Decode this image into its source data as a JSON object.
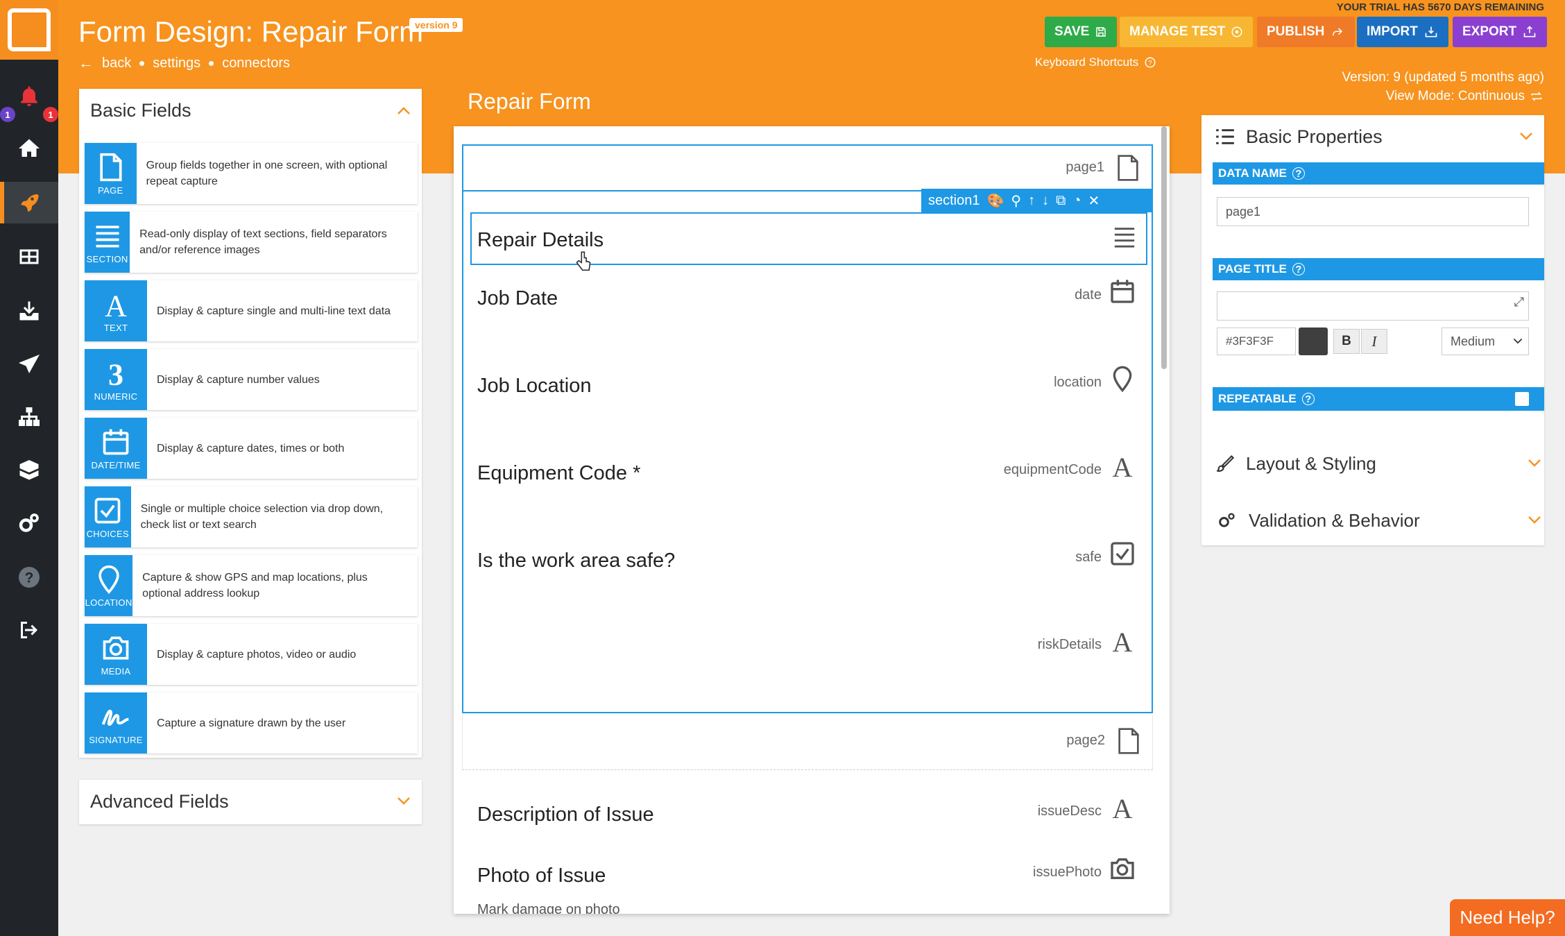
{
  "app": {
    "title": "Form Design: Repair Form",
    "version_tag": "version 9",
    "trial": "YOUR TRIAL HAS 5670 DAYS REMAINING"
  },
  "nav": {
    "back": "back",
    "settings": "settings",
    "connectors": "connectors"
  },
  "rail": {
    "notif_badge_left": "1",
    "notif_badge_right": "1",
    "icons": [
      "bell-icon",
      "home-icon",
      "rocket-icon",
      "table-icon",
      "download-icon",
      "send-icon",
      "sitemap-icon",
      "boxes-icon",
      "gears-icon",
      "help-icon",
      "logout-icon"
    ]
  },
  "toolbar": {
    "save": "SAVE",
    "manage_test": "MANAGE TEST",
    "publish": "PUBLISH",
    "import": "IMPORT",
    "export": "EXPORT",
    "keyboard_shortcuts": "Keyboard Shortcuts",
    "colors": {
      "save": "#2eab48",
      "manage": "#f7b733",
      "publish": "#ef7a27",
      "import": "#1a6fc2",
      "export": "#8a3fd1"
    }
  },
  "version_info": {
    "line1": "Version: 9 (updated 5 months ago)",
    "line2": "View Mode: Continuous"
  },
  "basic_fields": {
    "title": "Basic Fields",
    "items": [
      {
        "tile": "PAGE",
        "desc": "Group fields together in one screen, with optional repeat capture",
        "icon": "page-icon"
      },
      {
        "tile": "SECTION",
        "desc": "Read-only display of text sections, field separators and/or reference images",
        "icon": "section-icon"
      },
      {
        "tile": "TEXT",
        "desc": "Display & capture single and multi-line text data",
        "icon": "text-icon"
      },
      {
        "tile": "NUMERIC",
        "desc": "Display & capture number values",
        "icon": "numeric-icon"
      },
      {
        "tile": "DATE/TIME",
        "desc": "Display & capture dates, times or both",
        "icon": "calendar-icon"
      },
      {
        "tile": "CHOICES",
        "desc": "Single or multiple choice selection via drop down, check list or text search",
        "icon": "checkbox-icon"
      },
      {
        "tile": "LOCATION",
        "desc": "Capture & show GPS and map locations, plus optional address lookup",
        "icon": "location-icon"
      },
      {
        "tile": "MEDIA",
        "desc": "Display & capture photos, video or audio",
        "icon": "camera-icon"
      },
      {
        "tile": "SIGNATURE",
        "desc": "Capture a signature drawn by the user",
        "icon": "signature-icon"
      }
    ]
  },
  "advanced_fields": {
    "title": "Advanced Fields"
  },
  "canvas": {
    "title": "Repair Form",
    "page1": "page1",
    "section_tag": "section1",
    "section_title": "Repair Details",
    "page2": "page2",
    "fields": [
      {
        "label": "Job Date",
        "name": "date",
        "icon": "calendar-icon"
      },
      {
        "label": "Job Location",
        "name": "location",
        "icon": "location-icon"
      },
      {
        "label": "Equipment Code *",
        "name": "equipmentCode",
        "icon": "text-icon"
      },
      {
        "label": "Is the work area safe?",
        "name": "safe",
        "icon": "checkbox-icon"
      },
      {
        "label": "",
        "name": "riskDetails",
        "icon": "text-icon"
      }
    ],
    "fields2": [
      {
        "label": "Description of Issue",
        "name": "issueDesc",
        "icon": "text-icon"
      },
      {
        "label": "Photo of Issue",
        "name": "issuePhoto",
        "icon": "camera-icon"
      }
    ],
    "hint": "Mark damage on photo"
  },
  "props": {
    "title": "Basic Properties",
    "data_name_label": "DATA NAME",
    "data_name_value": "page1",
    "page_title_label": "PAGE TITLE",
    "page_title_value": "",
    "color_hex": "#3F3F3F",
    "bold": "B",
    "italic": "I",
    "size": "Medium",
    "repeatable_label": "REPEATABLE",
    "layout": "Layout & Styling",
    "validation": "Validation & Behavior"
  },
  "help": {
    "label": "Need Help?"
  }
}
